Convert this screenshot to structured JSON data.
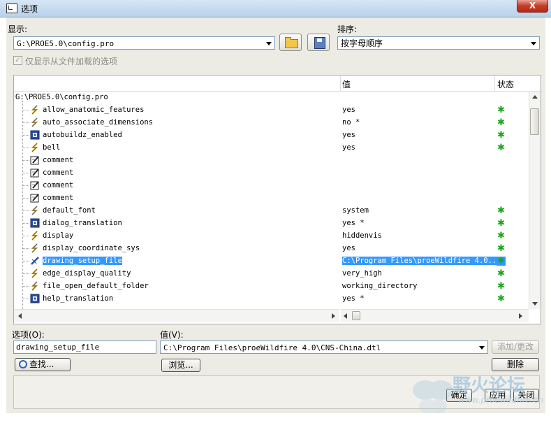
{
  "window": {
    "title": "选项",
    "close_label": "X"
  },
  "display": {
    "label": "显示:",
    "value": "G:\\PROE5.0\\config.pro",
    "only_loaded_checkbox_label": "仅显示从文件加载的选项",
    "only_loaded_checked": true
  },
  "sort": {
    "label": "排序:",
    "value": "按字母顺序"
  },
  "table": {
    "columns": {
      "value": "值",
      "status": "状态"
    },
    "root": "G:\\PROE5.0\\config.pro",
    "rows": [
      {
        "name": "allow_anatomic_features",
        "value": "yes",
        "icon": "lightning-icon",
        "status": true
      },
      {
        "name": "auto_associate_dimensions",
        "value": "no *",
        "icon": "lightning-icon",
        "status": true
      },
      {
        "name": "autobuildz_enabled",
        "value": "yes",
        "icon": "blue-square-icon",
        "status": true
      },
      {
        "name": "bell",
        "value": "yes",
        "icon": "lightning-icon",
        "status": true
      },
      {
        "name": "comment",
        "value": "",
        "icon": "note-pencil-icon",
        "status": false
      },
      {
        "name": "comment",
        "value": "",
        "icon": "note-pencil-icon",
        "status": false
      },
      {
        "name": "comment",
        "value": "",
        "icon": "note-pencil-icon",
        "status": false
      },
      {
        "name": "comment",
        "value": "",
        "icon": "note-pencil-icon",
        "status": false
      },
      {
        "name": "default_font",
        "value": "system",
        "icon": "lightning-icon",
        "status": true
      },
      {
        "name": "dialog_translation",
        "value": "yes *",
        "icon": "blue-square-icon",
        "status": true
      },
      {
        "name": "display",
        "value": "hiddenvis",
        "icon": "lightning-icon",
        "status": true
      },
      {
        "name": "display_coordinate_sys",
        "value": "yes",
        "icon": "lightning-icon",
        "status": true
      },
      {
        "name": "drawing_setup_file",
        "value": "C:\\Program Files\\proeWildfire 4.0...",
        "icon": "blue-pen-icon",
        "status": true,
        "selected": true
      },
      {
        "name": "edge_display_quality",
        "value": "very_high",
        "icon": "lightning-icon",
        "status": true
      },
      {
        "name": "file_open_default_folder",
        "value": "working_directory",
        "icon": "lightning-icon",
        "status": true
      },
      {
        "name": "help_translation",
        "value": "yes *",
        "icon": "blue-square-icon",
        "status": true
      }
    ]
  },
  "option": {
    "label": "选项(O):",
    "value": "drawing_setup_file",
    "find_button": "查找..."
  },
  "value_field": {
    "label": "值(V):",
    "value": "C:\\Program Files\\proeWildfire 4.0\\CNS-China.dtl",
    "browse_button": "浏览...",
    "add_change_button": "添加/更改",
    "delete_button": "删除"
  },
  "footer": {
    "ok": "确定",
    "apply": "应用",
    "close": "关闭"
  },
  "watermark": {
    "text": "野火论坛",
    "url": "www.proewildfire.cn"
  },
  "colors": {
    "status_green": "#18a818",
    "selection": "#3399ff"
  }
}
